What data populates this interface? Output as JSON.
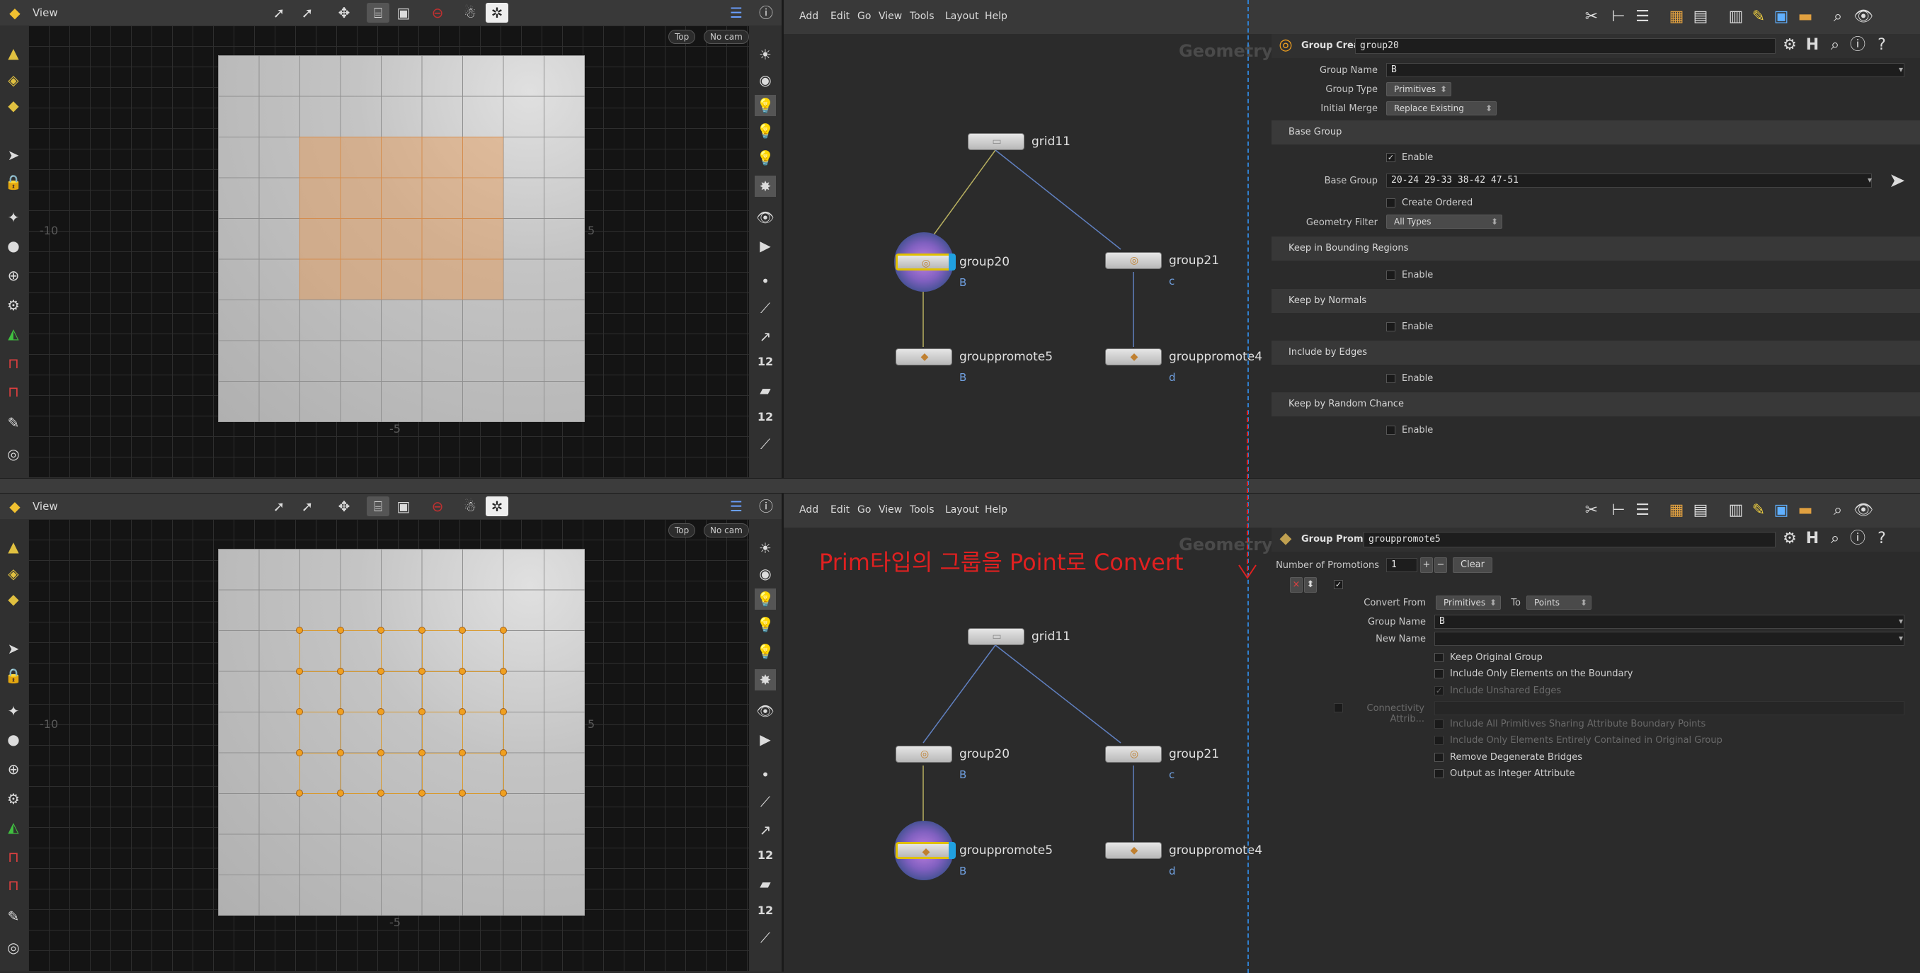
{
  "top": {
    "viewport": {
      "title": "View",
      "camera_view": "Top",
      "camera": "No cam",
      "axis_left": "-10",
      "axis_right": "5",
      "axis_bottom": "-5"
    },
    "network": {
      "menu": [
        "Add",
        "Edit",
        "Go",
        "View",
        "Tools",
        "Layout",
        "Help"
      ],
      "watermark": "Geometry",
      "nodes": {
        "grid": {
          "name": "grid11"
        },
        "g20": {
          "name": "group20",
          "sub": "B"
        },
        "g21": {
          "name": "group21",
          "sub": "c"
        },
        "gp5": {
          "name": "grouppromote5",
          "sub": "B"
        },
        "gp4": {
          "name": "grouppromote4",
          "sub": "d"
        }
      }
    },
    "params": {
      "node_type": "Group Create",
      "node_name": "group20",
      "group_name_label": "Group Name",
      "group_name": "B",
      "group_type_label": "Group Type",
      "group_type": "Primitives",
      "initial_merge_label": "Initial Merge",
      "initial_merge": "Replace Existing",
      "base_group_section": "Base Group",
      "enable_label": "Enable",
      "base_group_label": "Base Group",
      "base_group": "20-24 29-33 38-42 47-51",
      "create_ordered": "Create Ordered",
      "geometry_filter_label": "Geometry Filter",
      "geometry_filter": "All Types",
      "keep_bounding": "Keep in Bounding Regions",
      "keep_normals": "Keep by Normals",
      "include_edges": "Include by Edges",
      "keep_random": "Keep by Random Chance"
    }
  },
  "bottom": {
    "viewport": {
      "title": "View",
      "camera_view": "Top",
      "camera": "No cam",
      "axis_left": "-10",
      "axis_right": "5",
      "axis_bottom": "-5"
    },
    "network": {
      "menu": [
        "Add",
        "Edit",
        "Go",
        "View",
        "Tools",
        "Layout",
        "Help"
      ],
      "watermark": "Geometry",
      "annotation": "Prim타입의 그룹을 Point로 Convert",
      "nodes": {
        "grid": {
          "name": "grid11"
        },
        "g20": {
          "name": "group20",
          "sub": "B"
        },
        "g21": {
          "name": "group21",
          "sub": "c"
        },
        "gp5": {
          "name": "grouppromote5",
          "sub": "B"
        },
        "gp4": {
          "name": "grouppromote4",
          "sub": "d"
        }
      }
    },
    "params": {
      "node_type": "Group Promote",
      "node_name": "grouppromote5",
      "num_promotions_label": "Number of Promotions",
      "num_promotions": "1",
      "clear": "Clear",
      "convert_from_label": "Convert From",
      "convert_from": "Primitives",
      "to_label": "To",
      "to": "Points",
      "group_name_label": "Group Name",
      "group_name": "B",
      "new_name_label": "New Name",
      "new_name": "",
      "keep_original": "Keep Original Group",
      "only_boundary": "Include Only Elements on the Boundary",
      "unshared_edges": "Include Unshared Edges",
      "connectivity_label": "Connectivity Attrib...",
      "sharing_boundary": "Include All Primitives Sharing Attribute Boundary Points",
      "entirely_contained": "Include Only Elements Entirely Contained in Original Group",
      "remove_degenerate": "Remove Degenerate Bridges",
      "output_integer": "Output as Integer Attribute"
    }
  },
  "colors": {
    "selection": "#e0c000",
    "annotation": "#e02020",
    "dashed_guide": "#3080d0",
    "node_sub": "#70a0e0"
  }
}
